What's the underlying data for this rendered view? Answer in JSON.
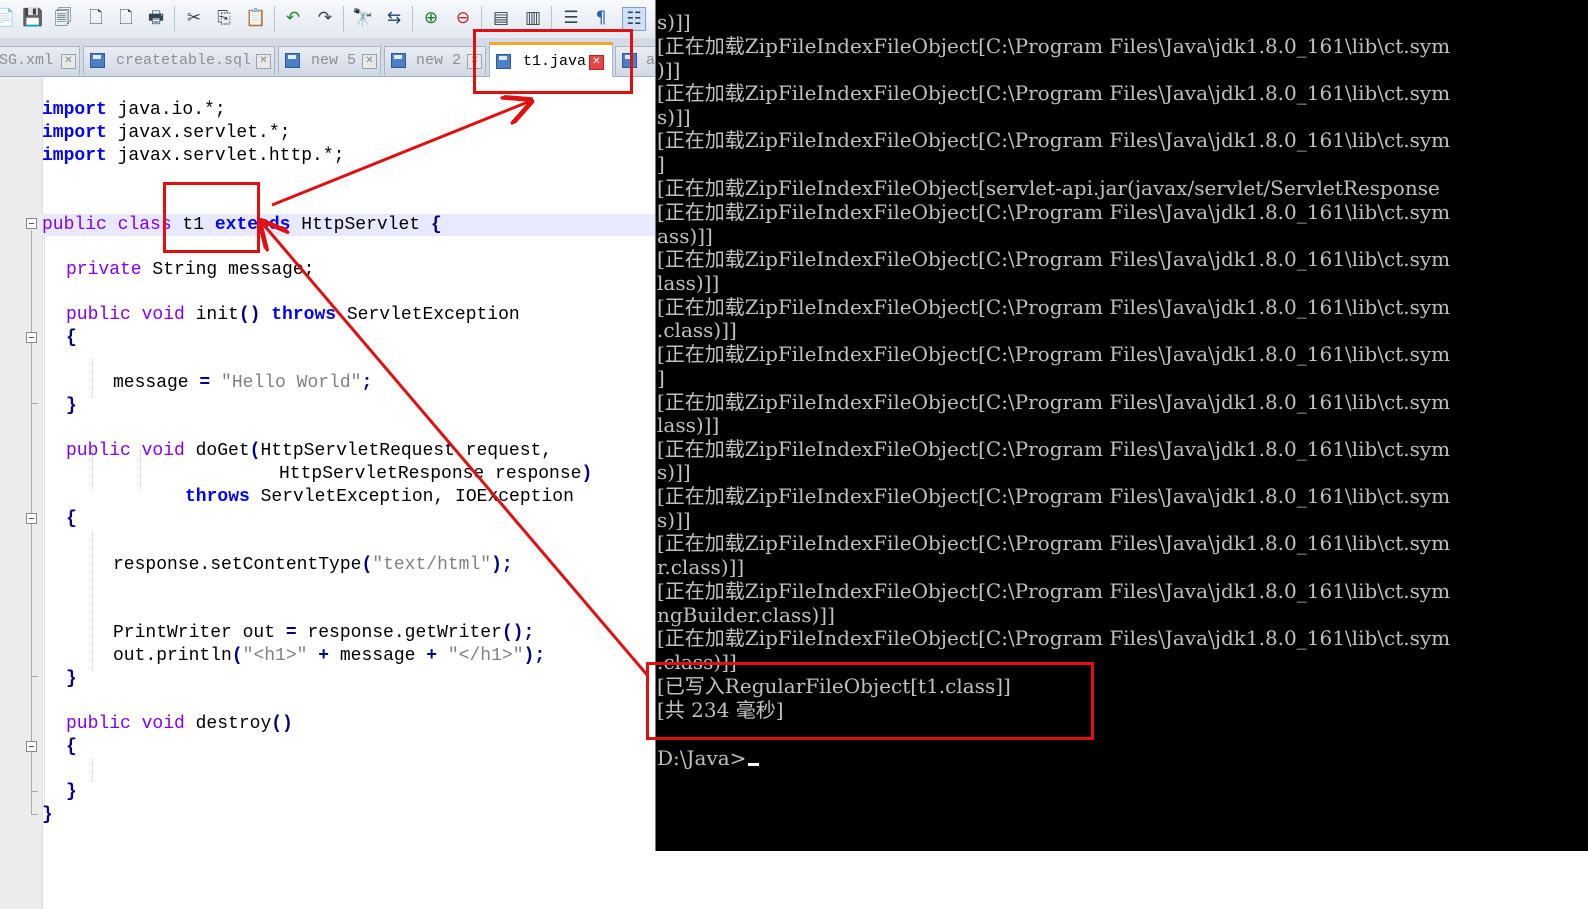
{
  "editor": {
    "tabs": [
      {
        "label": "SG.xml"
      },
      {
        "label": "createtable.sql"
      },
      {
        "label": "new 5"
      },
      {
        "label": "new 2"
      },
      {
        "label": "t1.java",
        "active": true
      },
      {
        "label": "a"
      }
    ],
    "code": {
      "l1a": "import",
      "l1b": " java.io.*;",
      "l2a": "import",
      "l2b": " javax.servlet.*;",
      "l3a": "import",
      "l3b": " javax.servlet.http.*;",
      "l5a": "public class",
      "l5b": " t1 ",
      "l5c": "extends",
      "l5d": " HttpServlet ",
      "l5e": "{",
      "l7a": "private",
      "l7b": " String message;",
      "l9a": "public void",
      "l9b": " init",
      "l9c": "()",
      "l9d": " throws",
      "l9e": " ServletException",
      "l10": "{",
      "l12a": "message ",
      "l12b": "=",
      "l12c": " \"Hello World\"",
      "l12d": ";",
      "l13": "}",
      "l15a": "public void",
      "l15b": " doGet",
      "l15c": "(",
      "l15d": "HttpServletRequest request,",
      "l16a": "HttpServletResponse response",
      "l16b": ")",
      "l17a": "throws",
      "l17b": " ServletException, IOException",
      "l18": "{",
      "l20a": "response.setContentType",
      "l20b": "(",
      "l20c": "\"text/html\"",
      "l20d": ");",
      "l23a": "PrintWriter out ",
      "l23b": "=",
      "l23c": " response.getWriter",
      "l23d": "();",
      "l24a": "out.println",
      "l24b": "(",
      "l24c": "\"<h1>\"",
      "l24d": " + ",
      "l24e": "message",
      "l24f": " + ",
      "l24g": "\"</h1>\"",
      "l24h": ");",
      "l25": "}",
      "l27a": "public void",
      "l27b": " destroy",
      "l27c": "()",
      "l28": "{",
      "l30": "}",
      "l31": "}"
    }
  },
  "console": {
    "lines": [
      "s)]]",
      "[正在加载ZipFileIndexFileObject[C:\\Program Files\\Java\\jdk1.8.0_161\\lib\\ct.sym",
      ")]]",
      "[正在加载ZipFileIndexFileObject[C:\\Program Files\\Java\\jdk1.8.0_161\\lib\\ct.sym",
      "s)]]",
      "[正在加载ZipFileIndexFileObject[C:\\Program Files\\Java\\jdk1.8.0_161\\lib\\ct.sym",
      "]",
      "[正在加载ZipFileIndexFileObject[servlet-api.jar(javax/servlet/ServletResponse",
      "[正在加载ZipFileIndexFileObject[C:\\Program Files\\Java\\jdk1.8.0_161\\lib\\ct.sym",
      "ass)]]",
      "[正在加载ZipFileIndexFileObject[C:\\Program Files\\Java\\jdk1.8.0_161\\lib\\ct.sym",
      "lass)]]",
      "[正在加载ZipFileIndexFileObject[C:\\Program Files\\Java\\jdk1.8.0_161\\lib\\ct.sym",
      ".class)]]",
      "[正在加载ZipFileIndexFileObject[C:\\Program Files\\Java\\jdk1.8.0_161\\lib\\ct.sym",
      "]",
      "[正在加载ZipFileIndexFileObject[C:\\Program Files\\Java\\jdk1.8.0_161\\lib\\ct.sym",
      "lass)]]",
      "[正在加载ZipFileIndexFileObject[C:\\Program Files\\Java\\jdk1.8.0_161\\lib\\ct.sym",
      "s)]]",
      "[正在加载ZipFileIndexFileObject[C:\\Program Files\\Java\\jdk1.8.0_161\\lib\\ct.sym",
      "s)]]",
      "[正在加载ZipFileIndexFileObject[C:\\Program Files\\Java\\jdk1.8.0_161\\lib\\ct.sym",
      "r.class)]]",
      "[正在加载ZipFileIndexFileObject[C:\\Program Files\\Java\\jdk1.8.0_161\\lib\\ct.sym",
      "ngBuilder.class)]]",
      "[正在加载ZipFileIndexFileObject[C:\\Program Files\\Java\\jdk1.8.0_161\\lib\\ct.sym",
      ".class)]]",
      "[已写入RegularFileObject[t1.class]]",
      "[共 234 毫秒]",
      "",
      "D:\\Java>"
    ]
  },
  "annotation_color": "#e01010"
}
